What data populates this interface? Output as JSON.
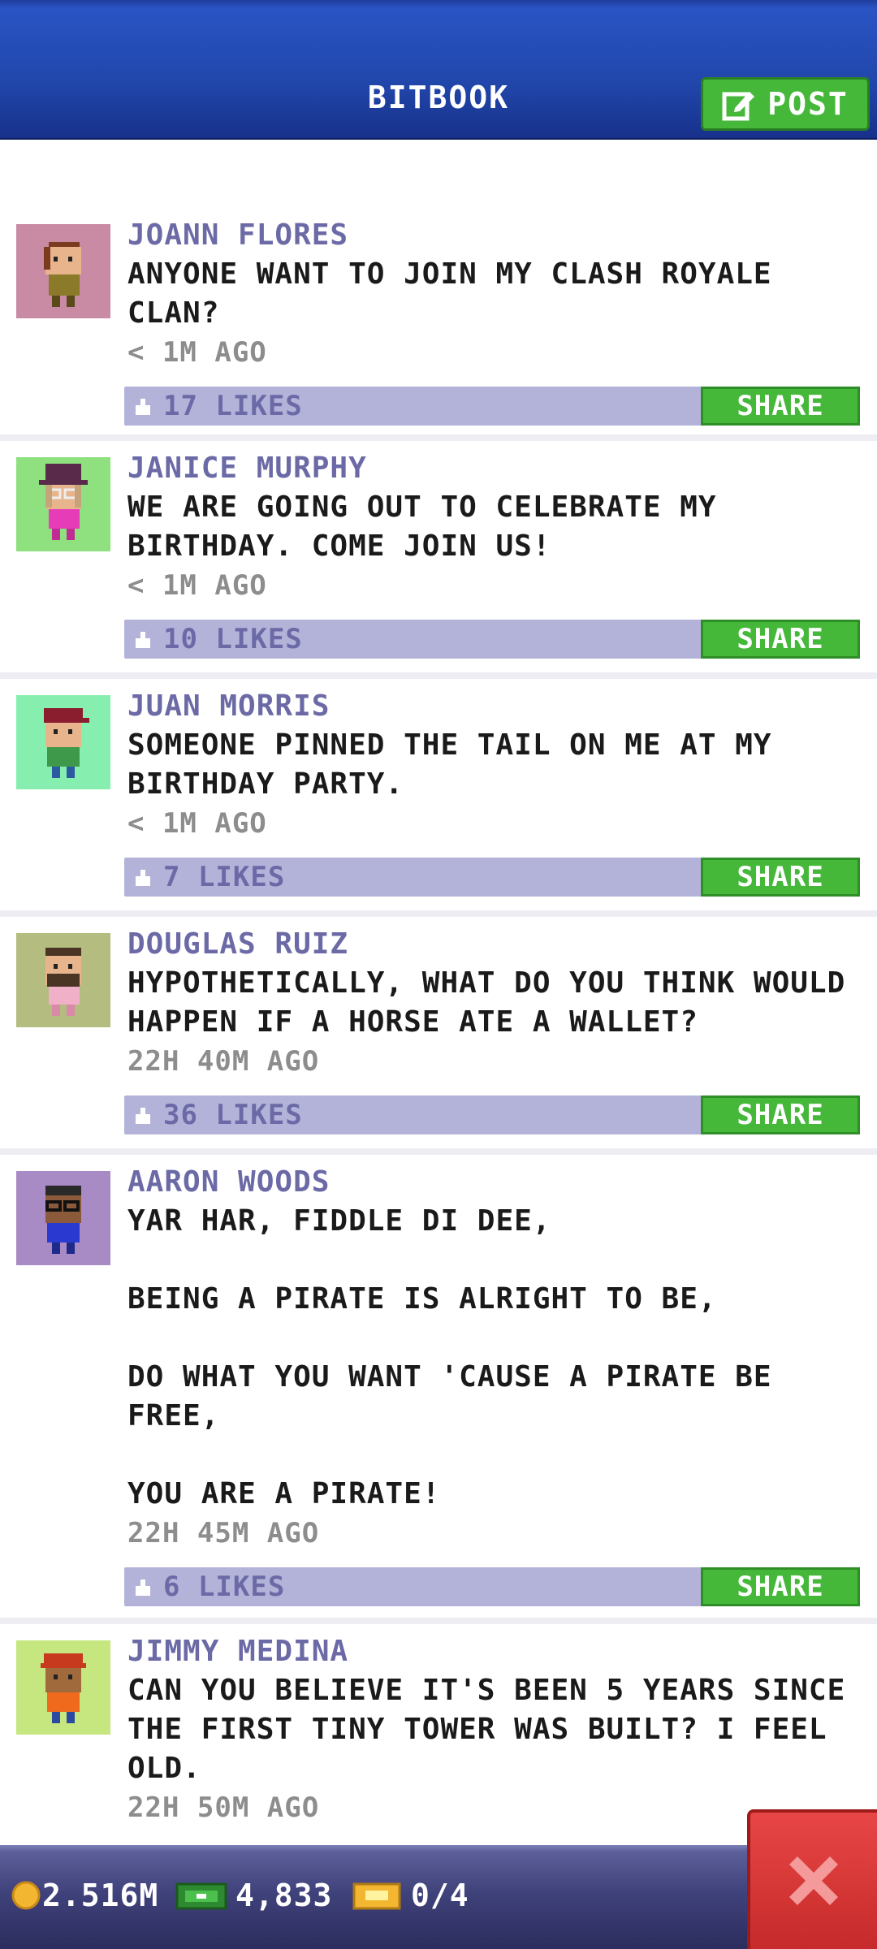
{
  "app": {
    "title": "BITBOOK",
    "post_button": "POST"
  },
  "posts": [
    {
      "author": "JOANN FLORES",
      "text": "ANYONE WANT TO JOIN MY CLASH ROYALE CLAN?",
      "time": "< 1M AGO",
      "likes": "17 LIKES",
      "share": "SHARE",
      "avatar_bg": "#c98aa4"
    },
    {
      "author": "JANICE MURPHY",
      "text": "WE ARE GOING OUT TO CELEBRATE MY BIRTHDAY. COME JOIN US!",
      "time": "< 1M AGO",
      "likes": "10 LIKES",
      "share": "SHARE",
      "avatar_bg": "#8fe07f"
    },
    {
      "author": "JUAN MORRIS",
      "text": "SOMEONE PINNED THE TAIL ON ME AT MY BIRTHDAY PARTY.",
      "time": "< 1M AGO",
      "likes": "7 LIKES",
      "share": "SHARE",
      "avatar_bg": "#86efb0"
    },
    {
      "author": "DOUGLAS RUIZ",
      "text": "HYPOTHETICALLY, WHAT DO YOU THINK WOULD HAPPEN IF A HORSE ATE A WALLET?",
      "time": "22H 40M AGO",
      "likes": "36 LIKES",
      "share": "SHARE",
      "avatar_bg": "#b4bc80"
    },
    {
      "author": "AARON WOODS",
      "text": "YAR HAR, FIDDLE DI DEE,\n\nBEING A PIRATE IS ALRIGHT TO BE,\n\nDO WHAT YOU WANT 'CAUSE A PIRATE BE FREE,\n\nYOU ARE A PIRATE!",
      "time": "22H 45M AGO",
      "likes": "6 LIKES",
      "share": "SHARE",
      "avatar_bg": "#a88bc4"
    },
    {
      "author": "JIMMY MEDINA",
      "text": "CAN YOU BELIEVE IT'S BEEN 5 YEARS SINCE THE FIRST TINY TOWER WAS BUILT? I FEEL OLD.",
      "time": "22H 50M AGO",
      "likes": "",
      "share": "",
      "avatar_bg": "#c6e680"
    }
  ],
  "resources": {
    "coins": "2.516M",
    "bux": "4,833",
    "tickets": "0/4"
  },
  "colors": {
    "header": "#2147ac",
    "accent_green": "#45b83a",
    "author_purple": "#6b6aa6",
    "like_bar": "#b3b3da",
    "close_red": "#d83434"
  }
}
